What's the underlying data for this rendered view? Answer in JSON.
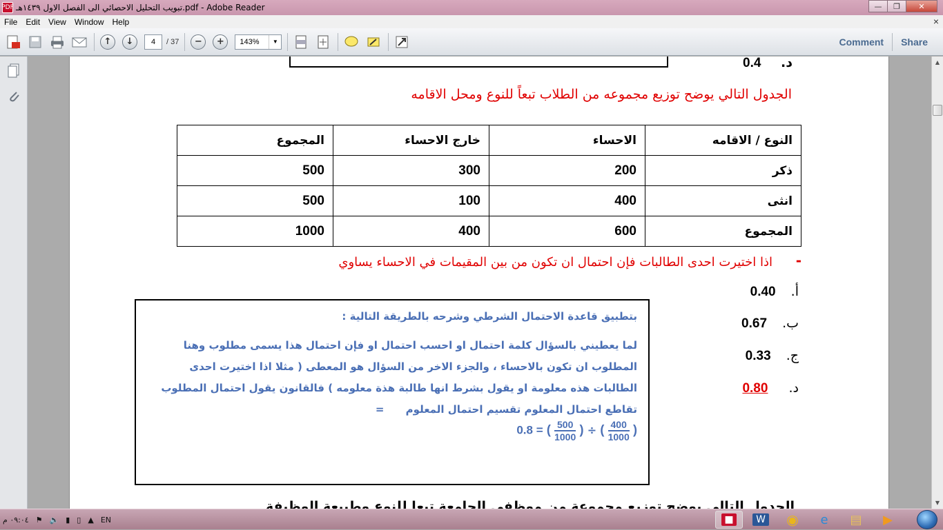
{
  "window": {
    "title": "تبويب التحليل الاحصائي الى الفصل الاول ١٤٣٩هـ.pdf - Adobe Reader",
    "app_icon_label": "PDF"
  },
  "menu": [
    "File",
    "Edit",
    "View",
    "Window",
    "Help"
  ],
  "toolbar": {
    "page_current": "4",
    "page_total": "/ 37",
    "zoom": "143%",
    "comment_label": "Comment",
    "share_label": "Share"
  },
  "document": {
    "prev_option_letter": "د.",
    "prev_option_value": "0.4",
    "table_intro": "الجدول التالي يوضح توزيع مجموعه من الطلاب تبعاً للنوع ومحل الاقامه",
    "table": {
      "headers": [
        "النوع / الاقامه",
        "الاحساء",
        "خارج الاحساء",
        "المجموع"
      ],
      "rows": [
        [
          "ذكر",
          "200",
          "300",
          "500"
        ],
        [
          "انثى",
          "400",
          "100",
          "500"
        ],
        [
          "المجموع",
          "600",
          "400",
          "1000"
        ]
      ]
    },
    "question_bullet": "-",
    "question": "اذا اختيرت احدى الطالبات فإن احتمال ان تكون من بين المقيمات في الاحساء يساوي",
    "options": [
      {
        "letter": "أ.",
        "value": "0.40"
      },
      {
        "letter": "ب.",
        "value": "0.67"
      },
      {
        "letter": "ج.",
        "value": "0.33"
      },
      {
        "letter": "د.",
        "value": "0.80"
      }
    ],
    "correct_color": "#e00000",
    "explanation": {
      "heading": "بتطبيق قاعدة الاحتمال الشرطي وشرحه بالطريقة التالية :",
      "line1": "لما يعطيني بالسؤال كلمة احتمال او احسب احتمال او فإن احتمال هذا يسمى مطلوب وهنا",
      "line2": "المطلوب ان تكون بالاحساء ، والجزء الاخر من السؤال هو المعطى ( مثلا اذا اختيرت احدى",
      "line3": "الطالبات هذه معلومة او يقول بشرط انها طالبة هذة معلومه ) فالقانون يقول احتمال المطلوب",
      "line4": "تقاطع احتمال المعلوم تقسيم احتمال المعلوم",
      "equals": "=",
      "frac1_num": "400",
      "frac1_den": "1000",
      "frac2_num": "500",
      "frac2_den": "1000",
      "div_sign": "÷",
      "result": "0.8 =",
      "text_color": "#4a6fb5"
    },
    "next_heading_partial": "الجدول التالي يوضح توزيع مجموعة من موظفي الجامعة تبعا للنوع وطبيعة الوظيفة"
  },
  "taskbar": {
    "clock": "٠٩:٠٤ م",
    "language": "EN"
  }
}
